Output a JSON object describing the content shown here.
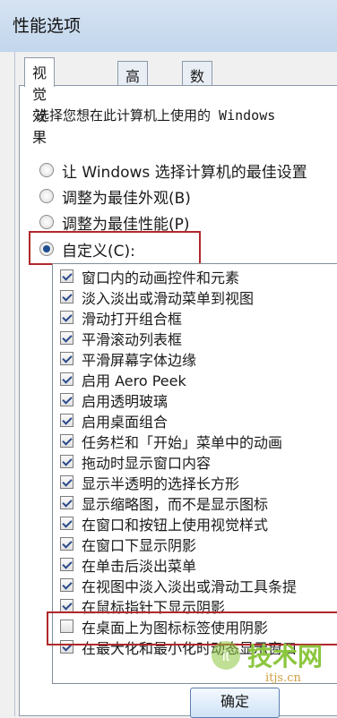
{
  "window": {
    "title": "性能选项"
  },
  "tabs": [
    {
      "label": "视觉效果",
      "active": true
    },
    {
      "label": "高级",
      "active": false
    },
    {
      "label": "数据执行保护",
      "active": false
    }
  ],
  "description": {
    "prefix": "选择您想在此计算机上使用的",
    "suffix": " Windows"
  },
  "radios": [
    {
      "label": "让 Windows 选择计算机的最佳设置",
      "checked": false
    },
    {
      "label": "调整为最佳外观(B)",
      "checked": false
    },
    {
      "label": "调整为最佳性能(P)",
      "checked": false
    },
    {
      "label": "自定义(C):",
      "checked": true
    }
  ],
  "options": [
    {
      "label": "窗口内的动画控件和元素",
      "checked": true
    },
    {
      "label": "淡入淡出或滑动菜单到视图",
      "checked": true
    },
    {
      "label": "滑动打开组合框",
      "checked": true
    },
    {
      "label": "平滑滚动列表框",
      "checked": true
    },
    {
      "label": "平滑屏幕字体边缘",
      "checked": true
    },
    {
      "label": "启用 Aero Peek",
      "checked": true
    },
    {
      "label": "启用透明玻璃",
      "checked": true
    },
    {
      "label": "启用桌面组合",
      "checked": true
    },
    {
      "label": "任务栏和「开始」菜单中的动画",
      "checked": true
    },
    {
      "label": "拖动时显示窗口内容",
      "checked": true
    },
    {
      "label": "显示半透明的选择长方形",
      "checked": true
    },
    {
      "label": "显示缩略图，而不是显示图标",
      "checked": true
    },
    {
      "label": "在窗口和按钮上使用视觉样式",
      "checked": true
    },
    {
      "label": "在窗口下显示阴影",
      "checked": true
    },
    {
      "label": "在单击后淡出菜单",
      "checked": true
    },
    {
      "label": "在视图中淡入淡出或滑动工具条提",
      "checked": true
    },
    {
      "label": "在鼠标指针下显示阴影",
      "checked": true
    },
    {
      "label": "在桌面上为图标标签使用阴影",
      "checked": false
    },
    {
      "label": "在最大化和最小化时动态显示窗口",
      "checked": true
    }
  ],
  "buttons": {
    "ok": "确定"
  },
  "watermark": {
    "brand": "技术网",
    "url": "itjs.cn"
  }
}
